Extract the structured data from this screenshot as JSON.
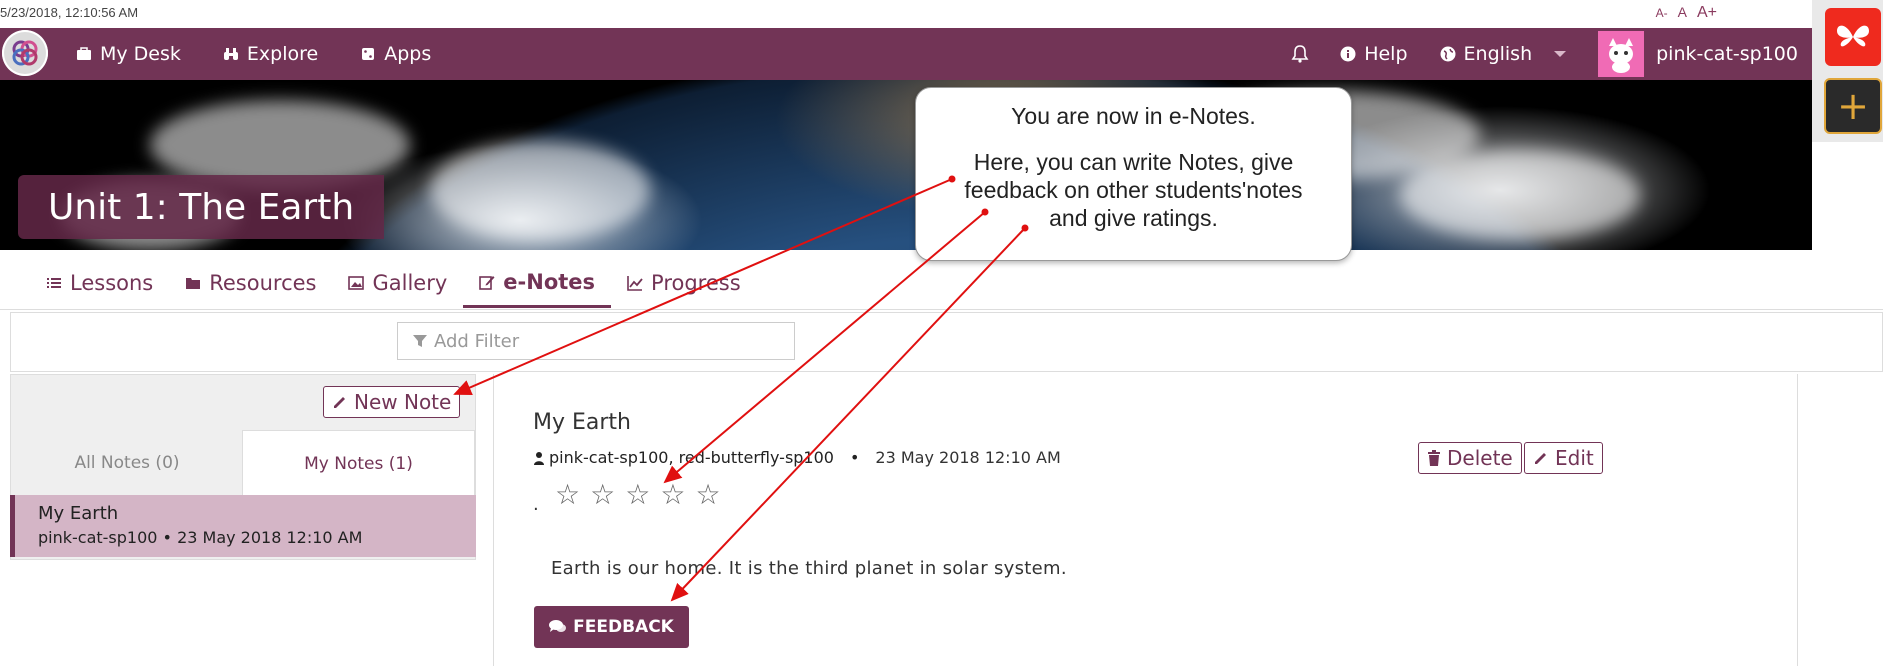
{
  "timestamp": "5/23/2018, 12:10:56 AM",
  "font_sizer": {
    "small": "A-",
    "normal": "A",
    "large": "A+"
  },
  "nav": {
    "items": [
      {
        "label": "My Desk",
        "icon": "briefcase-icon"
      },
      {
        "label": "Explore",
        "icon": "binoculars-icon"
      },
      {
        "label": "Apps",
        "icon": "dice-icon"
      }
    ],
    "help": "Help",
    "language": "English",
    "username": "pink-cat-sp100"
  },
  "banner": {
    "unit_title": "Unit 1: The Earth"
  },
  "tabs": [
    {
      "label": "Lessons",
      "icon": "list-icon"
    },
    {
      "label": "Resources",
      "icon": "folder-icon"
    },
    {
      "label": "Gallery",
      "icon": "image-icon"
    },
    {
      "label": "e-Notes",
      "icon": "edit-icon",
      "active": true
    },
    {
      "label": "Progress",
      "icon": "line-chart-icon"
    }
  ],
  "filter": {
    "placeholder": "Add Filter"
  },
  "notes_panel": {
    "new_note": "New Note",
    "tab_all": "All Notes (0)",
    "tab_mine": "My Notes (1)",
    "items": [
      {
        "title": "My Earth",
        "meta": "pink-cat-sp100 • 23 May 2018 12:10 AM"
      }
    ]
  },
  "note": {
    "title": "My Earth",
    "authors": "pink-cat-sp100, red-butterfly-sp100",
    "separator": "•",
    "date": "23 May 2018 12:10 AM",
    "period": ".",
    "rating": 0,
    "rating_max": 5,
    "content": "Earth is our home. It is the third planet in solar system.",
    "delete": "Delete",
    "edit": "Edit",
    "feedback": "FEEDBACK"
  },
  "callout": {
    "line1": "You are now in e-Notes.",
    "line2": "Here, you can write Notes, give",
    "line3": "feedback on other students'notes",
    "line4": "and give ratings."
  },
  "colors": {
    "brand": "#723456",
    "selected_note": "#d4b5c6",
    "arrow": "#e01010"
  }
}
